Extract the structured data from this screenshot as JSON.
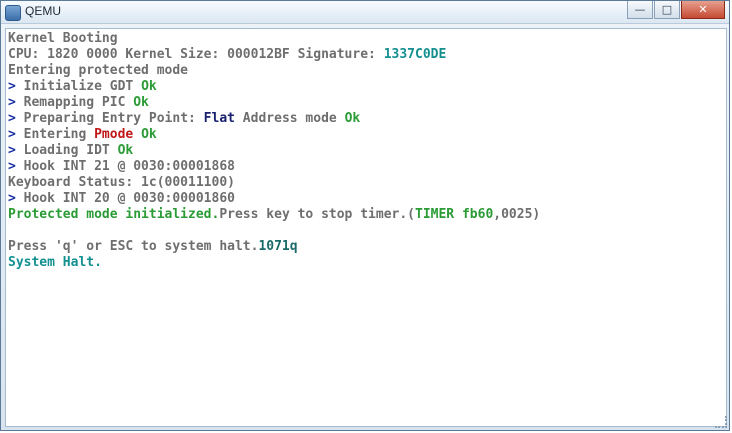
{
  "window": {
    "title": "QEMU",
    "min_label": "—",
    "max_label": "□",
    "close_label": "✕"
  },
  "console": {
    "l1": "Kernel Booting",
    "l2_a": "CPU: 1820 0000 Kernel Size: 000012BF Signature: ",
    "l2_sig": "1337C0DE",
    "l3": "Entering protected mode",
    "l4_text": " Initialize GDT ",
    "l5_text": " Remapping PIC ",
    "l6_text": " Preparing Entry Point: ",
    "l6_flat": "Flat",
    "l6_rest": " Address mode ",
    "l7_text": " Entering ",
    "l7_pmode": "Pmode",
    "l7_sp": " ",
    "l8_text": " Loading IDT ",
    "l9_text": " Hook INT 21 @ 0030:00001868",
    "l10": "Keyboard Status: 1c(00011100)",
    "l11_text": " Hook INT 20 @ 0030:00001860",
    "l12_green": "Protected mode initialized.",
    "l12_text": "Press key to stop timer.(",
    "l12_timer": "TIMER fb60",
    "l12_tail": ",0025)",
    "l14_text": "Press 'q' or ESC to system halt.",
    "l14_key": "1071q",
    "l15": "System Halt.",
    "prompt": ">",
    "ok": "Ok"
  },
  "colors": {
    "ok": "#2a9b35",
    "prompt": "#1a2fa5",
    "pmode": "#c01818",
    "cyan": "#129090"
  }
}
